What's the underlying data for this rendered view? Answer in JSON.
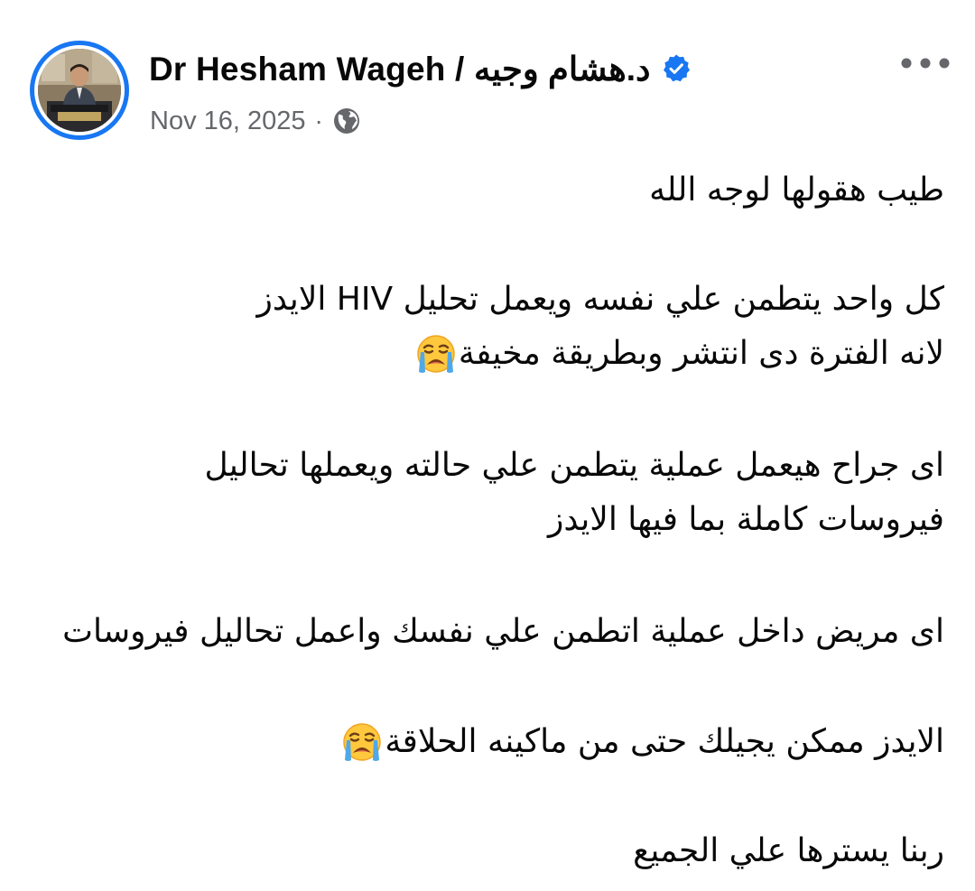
{
  "post": {
    "author": {
      "name": "Dr Hesham Wageh / د.هشام وجيه",
      "verified": true
    },
    "date": "Nov 16, 2025",
    "separator": "·",
    "audience_icon": "globe-icon",
    "more_icon": "more-horizontal-icon",
    "body": {
      "p1_line1": "طيب هقولها لوجه الله",
      "p2_line1": "كل واحد يتطمن علي نفسه ويعمل تحليل HIV الايدز",
      "p2_line2": "لانه الفترة دى انتشر وبطريقة مخيفة",
      "p3_line1": "اى جراح هيعمل عملية يتطمن علي حالته ويعملها تحاليل",
      "p3_line2": "فيروسات كاملة بما فيها الايدز",
      "p4_line1": "اى مريض داخل عملية اتطمن علي نفسك واعمل تحاليل فيروسات",
      "p5_line1": "الايدز ممكن يجيلك حتى من ماكينه الحلاقة",
      "p6_line1": "ربنا يسترها علي الجميع"
    },
    "emoji": "loudly-crying-face",
    "colors": {
      "accent": "#1877f2",
      "text": "#080809",
      "secondary_text": "#65676b"
    }
  }
}
